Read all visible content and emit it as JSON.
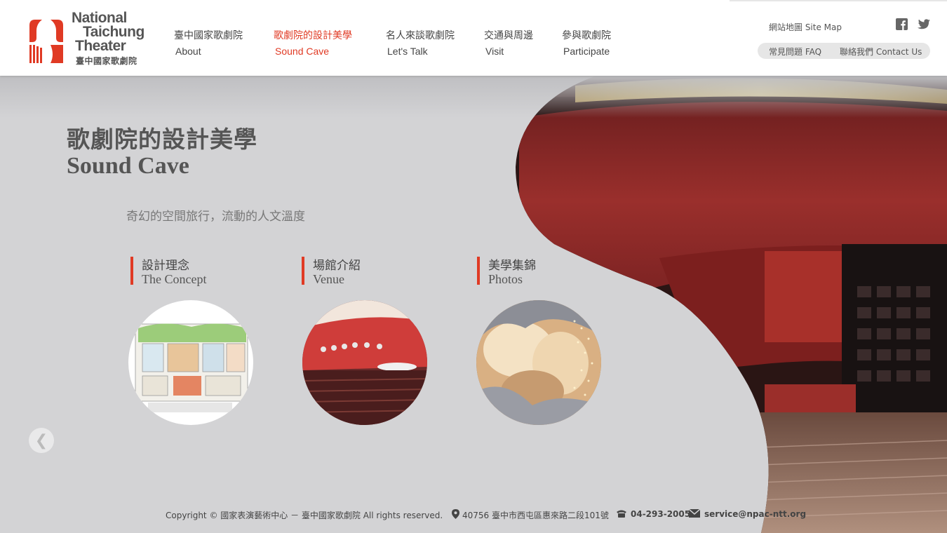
{
  "logo": {
    "en_line1": "National",
    "en_line2": "Taichung",
    "en_line3": "Theater",
    "zh": "臺中國家歌劇院"
  },
  "nav": [
    {
      "zh": "臺中國家歌劇院",
      "en": "About",
      "active": false
    },
    {
      "zh": "歌劇院的設計美學",
      "en": "Sound Cave",
      "active": true
    },
    {
      "zh": "名人來談歌劇院",
      "en": "Let's Talk",
      "active": false
    },
    {
      "zh": "交通與周邊",
      "en": "Visit",
      "active": false
    },
    {
      "zh": "參與歌劇院",
      "en": "Participate",
      "active": false
    }
  ],
  "utility": {
    "sitemap": "網站地圖 Site Map",
    "faq": "常見問題 FAQ",
    "contact": "聯絡我們 Contact Us",
    "facebook_icon": "facebook-icon",
    "twitter_icon": "twitter-icon"
  },
  "page": {
    "title_zh": "歌劇院的設計美學",
    "title_en": "Sound Cave",
    "subtitle": "奇幻的空間旅行，流動的人文溫度"
  },
  "sections": [
    {
      "zh": "設計理念",
      "en": "The Concept"
    },
    {
      "zh": "場館介紹",
      "en": "Venue"
    },
    {
      "zh": "美學集錦",
      "en": "Photos"
    }
  ],
  "prev_arrow": "❮",
  "footer": {
    "copyright": "Copyright © 國家表演藝術中心 － 臺中國家歌劇院 All rights reserved.",
    "address": "40756 臺中市西屯區惠來路二段101號",
    "phone": "04-293-2005",
    "email": "service@npac-ntt.org"
  },
  "colors": {
    "accent": "#e03a24",
    "background": "#d3d3d5",
    "theater_red": "#8e2a2a"
  }
}
